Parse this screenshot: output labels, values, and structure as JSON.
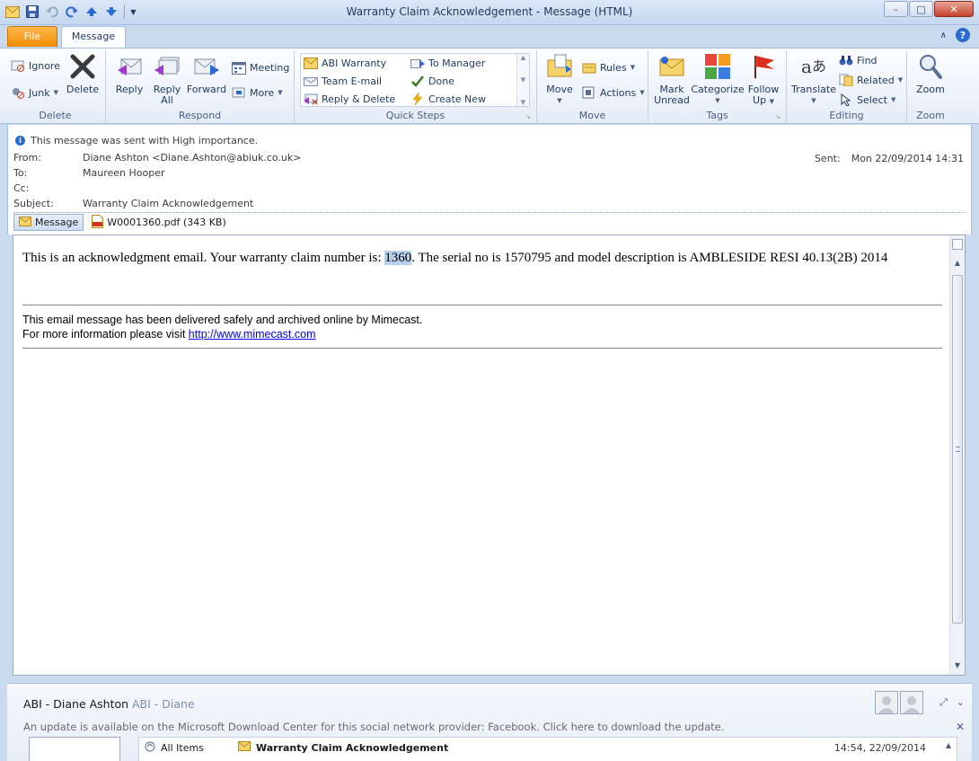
{
  "window": {
    "title": "Warranty Claim Acknowledgement  -  Message (HTML)",
    "controls": {
      "minimize": "–",
      "maximize": "□",
      "close": "✕"
    }
  },
  "tabs": {
    "file": "File",
    "message": "Message"
  },
  "ribbon": {
    "delete_group": {
      "label": "Delete",
      "ignore": "Ignore",
      "junk": "Junk",
      "delete": "Delete"
    },
    "respond_group": {
      "label": "Respond",
      "reply": "Reply",
      "reply_all_1": "Reply",
      "reply_all_2": "All",
      "forward": "Forward",
      "meeting": "Meeting",
      "more": "More"
    },
    "quick_steps_group": {
      "label": "Quick Steps",
      "items": [
        "ABI Warranty",
        "To Manager",
        "Team E-mail",
        "Done",
        "Reply & Delete",
        "Create New"
      ]
    },
    "move_group": {
      "label": "Move",
      "move": "Move",
      "rules": "Rules",
      "actions": "Actions"
    },
    "tags_group": {
      "label": "Tags",
      "mark_unread_1": "Mark",
      "mark_unread_2": "Unread",
      "categorize": "Categorize",
      "follow_up_1": "Follow",
      "follow_up_2": "Up"
    },
    "editing_group": {
      "label": "Editing",
      "translate": "Translate",
      "find": "Find",
      "related": "Related",
      "select": "Select"
    },
    "zoom_group": {
      "label": "Zoom",
      "zoom": "Zoom"
    }
  },
  "message": {
    "importance": "This message was sent with High importance.",
    "from_label": "From:",
    "from_value": "Diane Ashton <Diane.Ashton@abiuk.co.uk>",
    "to_label": "To:",
    "to_value": "Maureen Hooper",
    "cc_label": "Cc:",
    "cc_value": "",
    "subject_label": "Subject:",
    "subject_value": "Warranty Claim Acknowledgement",
    "sent_label": "Sent:",
    "sent_value": "Mon 22/09/2014 14:31",
    "attachments": [
      {
        "label": "Message",
        "selected": true
      },
      {
        "label": "W0001360.pdf (343 KB)",
        "selected": false
      }
    ]
  },
  "body": {
    "text_before": "This is an acknowledgment email. Your warranty claim number is: ",
    "claim_number": "1360",
    "text_after": ". The serial no is 1570795 and model description is AMBLESIDE RESI 40.13(2B) 2014",
    "mimecast_line1": "This email message has been delivered safely and archived online by Mimecast.",
    "mimecast_line2": "For more information please visit ",
    "mimecast_link": "http://www.mimecast.com"
  },
  "people_pane": {
    "name": "ABI - Diane Ashton",
    "name_secondary": "ABI - Diane",
    "update_notice": "An update is available on the Microsoft Download Center for this social network provider: Facebook. Click here to download the update.",
    "feed_all": "All Items",
    "feed_subject": "Warranty Claim Acknowledgement",
    "feed_time": "14:54, 22/09/2014"
  },
  "colors": {
    "file_tab": "#f08c00",
    "highlight": "#b5cfec",
    "link": "#0000ee",
    "accent": "#2a6ad3"
  }
}
